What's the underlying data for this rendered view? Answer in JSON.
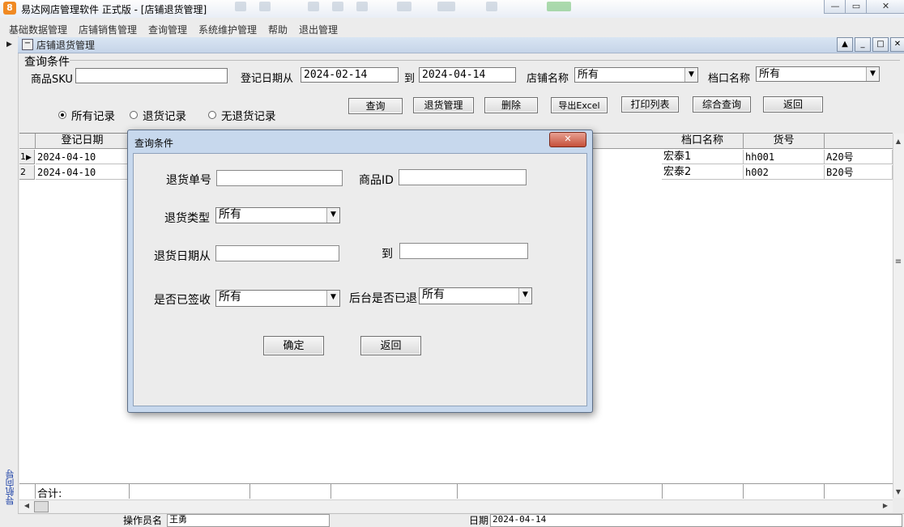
{
  "window": {
    "app_icon_glyph": "8",
    "title": "易达网店管理软件  正式版    - [店铺退货管理]",
    "controls": [
      "—",
      "▭",
      "✕"
    ]
  },
  "menu": [
    "基础数据管理",
    "店铺销售管理",
    "查询管理",
    "系统维护管理",
    "帮助",
    "退出管理"
  ],
  "child_window": {
    "title": "店铺退货管理",
    "icon_glyph": "−",
    "controls": [
      "▲",
      "_",
      "□",
      "✕"
    ]
  },
  "navigation": {
    "label": "导航向导",
    "arrow": "▶"
  },
  "query": {
    "group_label": "查询条件",
    "sku_label": "商品SKU",
    "sku_value": "",
    "date_from_label": "登记日期从",
    "date_from": "2024-02-14",
    "date_to_label": "到",
    "date_to": "2024-04-14",
    "store_label": "店铺名称",
    "store_value": "所有",
    "stall_label": "档口名称",
    "stall_value": "所有",
    "radios": [
      {
        "label": "所有记录",
        "checked": true
      },
      {
        "label": "退货记录",
        "checked": false
      },
      {
        "label": "无退货记录",
        "checked": false
      }
    ],
    "buttons": [
      "查询",
      "退货管理",
      "删除",
      "导出Excel",
      "打印列表",
      "综合查询",
      "返回"
    ]
  },
  "grid": {
    "columns": {
      "date": "登记日期",
      "stall": "档口名称",
      "item_no": "货号",
      "last": ""
    },
    "rows": [
      {
        "index": "1",
        "marker": "▶",
        "date": "2024-04-10",
        "stall": "宏泰1",
        "item_no": "hh001",
        "last": "A20号"
      },
      {
        "index": "2",
        "marker": "",
        "date": "2024-04-10",
        "stall": "宏泰2",
        "item_no": "h002",
        "last": "B20号"
      }
    ],
    "total_label": "合计:"
  },
  "status": {
    "operator_label": "操作员名",
    "operator": "王勇",
    "date_label": "日期",
    "date": "2024-04-14"
  },
  "dialog": {
    "title": "查询条件",
    "close": "✕",
    "return_no_label": "退货单号",
    "return_no": "",
    "product_id_label": "商品ID",
    "product_id": "",
    "return_type_label": "退货类型",
    "return_type": "所有",
    "return_date_from_label": "退货日期从",
    "return_date_from": "",
    "return_date_to_label": "到",
    "return_date_to": "",
    "signed_label": "是否已签收",
    "signed": "所有",
    "backend_label": "后台是否已退",
    "backend": "所有",
    "ok": "确定",
    "back": "返回"
  }
}
